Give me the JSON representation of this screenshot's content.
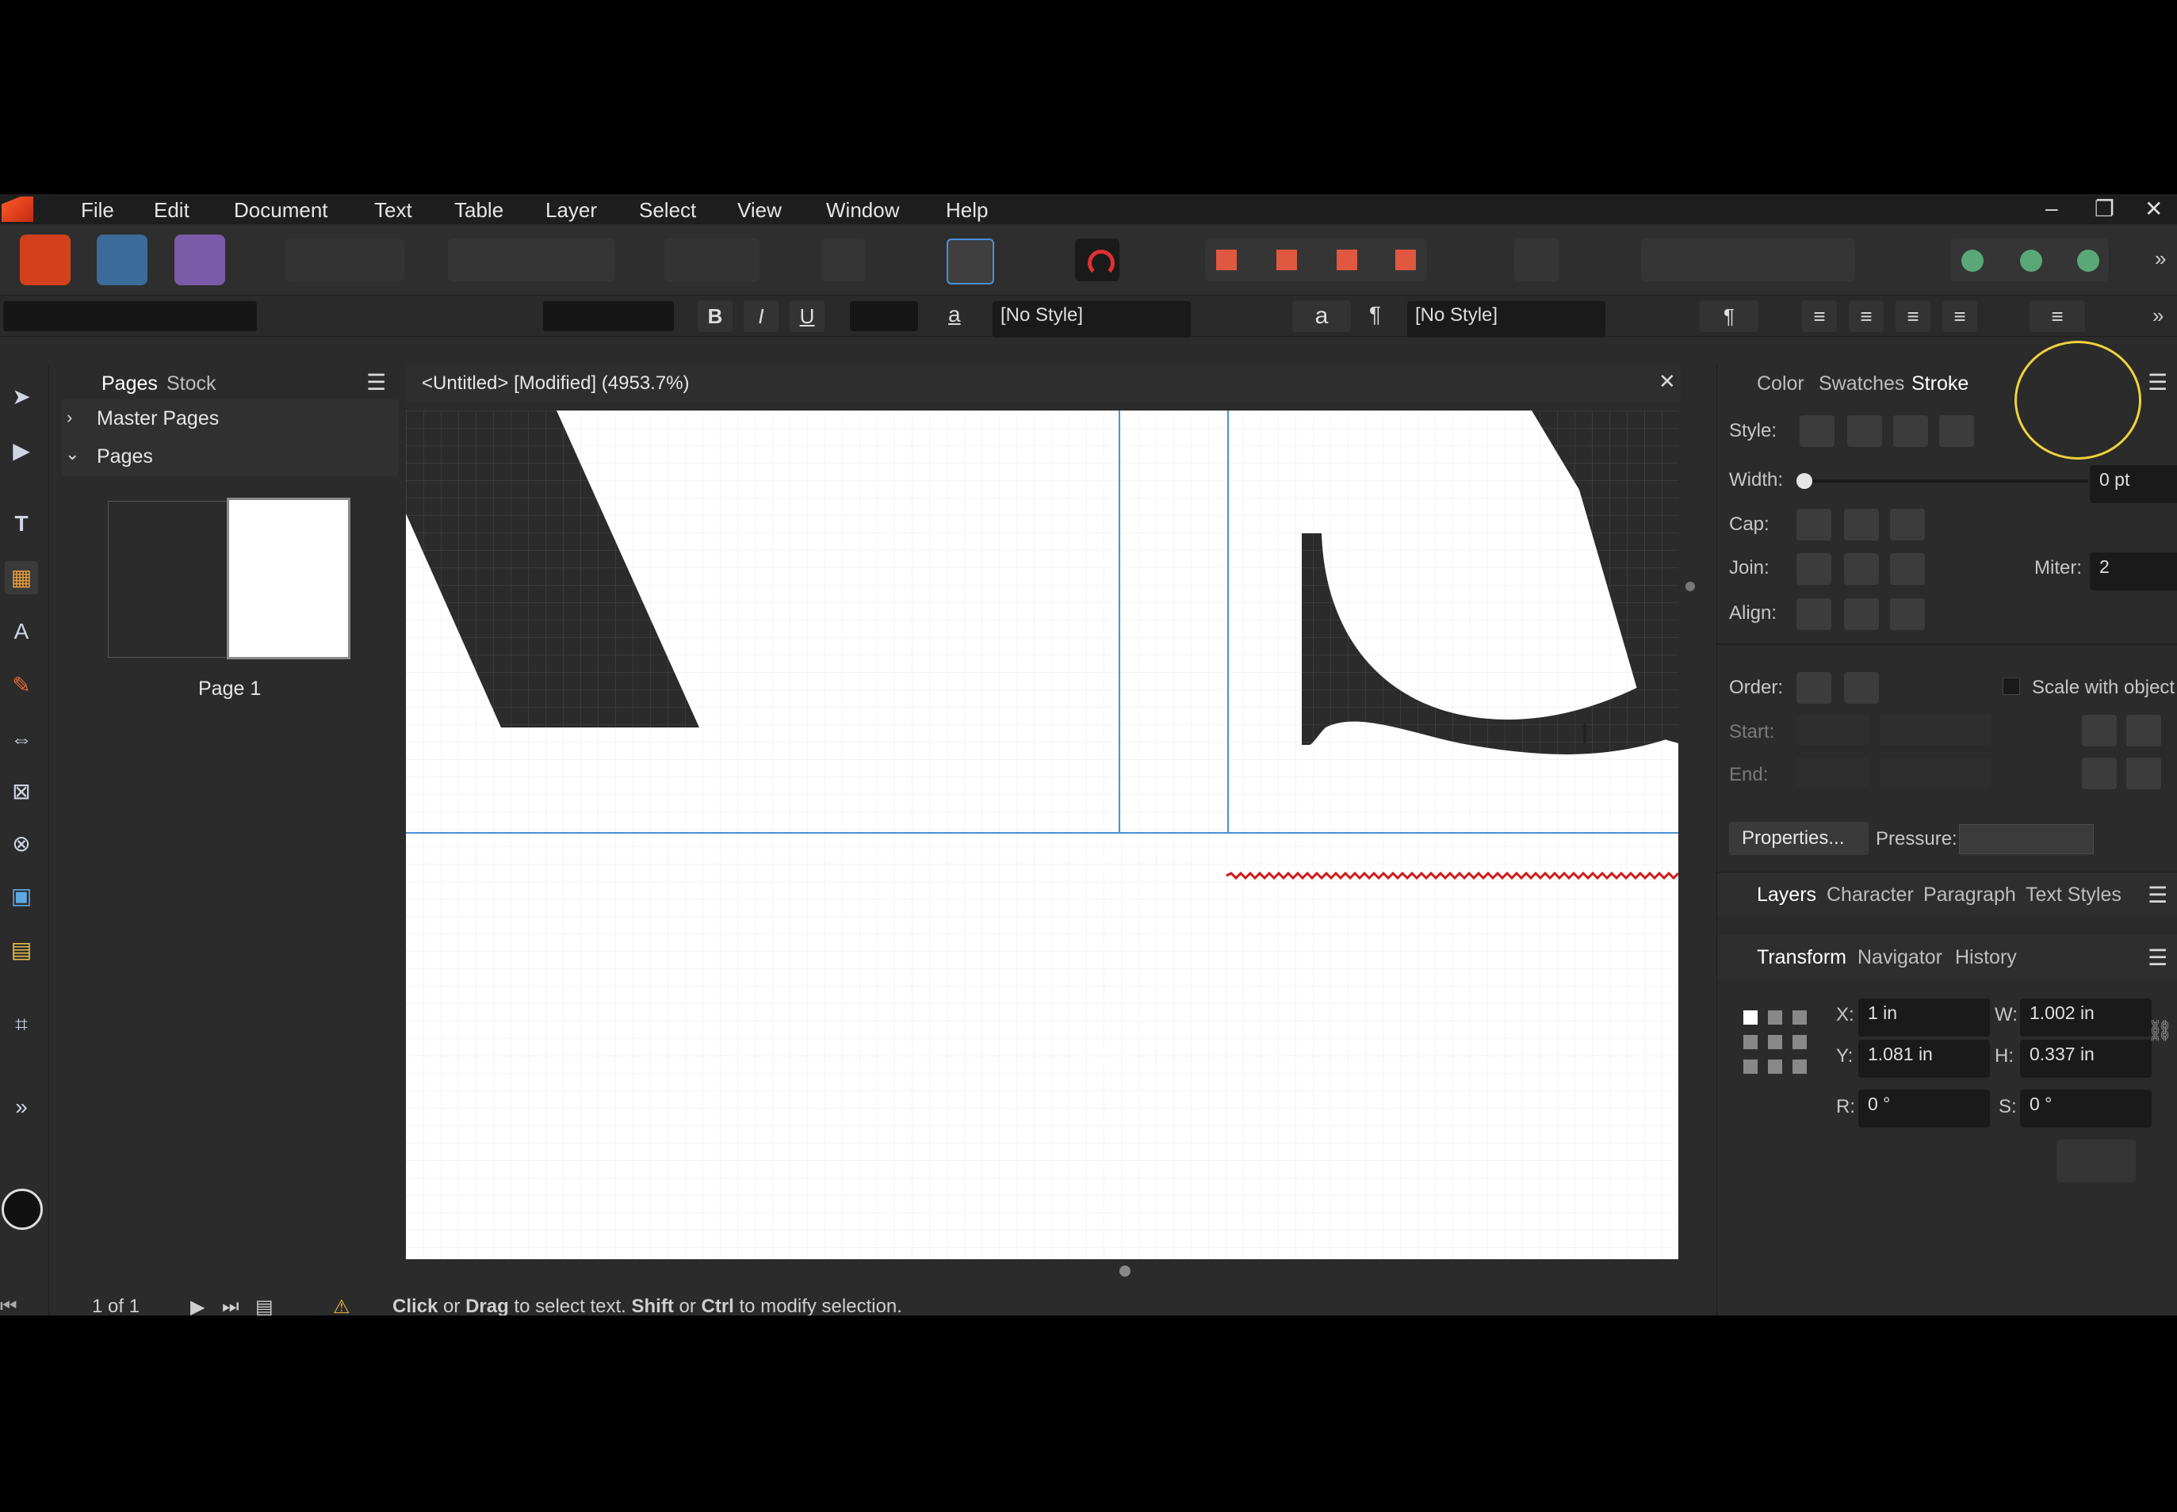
{
  "menu": [
    "File",
    "Edit",
    "Document",
    "Text",
    "Table",
    "Layer",
    "Select",
    "View",
    "Window",
    "Help"
  ],
  "context": {
    "char_style": "[No Style]",
    "para_style": "[No Style]",
    "bold": "B",
    "italic": "I",
    "underline": "U",
    "a_glyph": "a",
    "pilcrow": "¶"
  },
  "pages_panel": {
    "tab_pages": "Pages",
    "tab_stock": "Stock",
    "master_pages": "Master Pages",
    "pages": "Pages",
    "page1": "Page 1"
  },
  "document": {
    "title": "<Untitled> [Modified] (4953.7%)"
  },
  "stroke_panel": {
    "tabs": [
      "Color",
      "Swatches",
      "Stroke"
    ],
    "style_label": "Style:",
    "width_label": "Width:",
    "width_value": "0 pt",
    "cap_label": "Cap:",
    "join_label": "Join:",
    "miter_label": "Miter:",
    "miter_value": "2",
    "align_label": "Align:",
    "order_label": "Order:",
    "scale_label": "Scale with object",
    "start_label": "Start:",
    "end_label": "End:",
    "properties_button": "Properties...",
    "pressure_label": "Pressure:"
  },
  "layers_tabs": [
    "Layers",
    "Character",
    "Paragraph",
    "Text Styles"
  ],
  "transform_tabs": [
    "Transform",
    "Navigator",
    "History"
  ],
  "transform": {
    "x_label": "X:",
    "x_value": "1 in",
    "y_label": "Y:",
    "y_value": "1.081 in",
    "w_label": "W:",
    "w_value": "1.002 in",
    "h_label": "H:",
    "h_value": "0.337 in",
    "r_label": "R:",
    "r_value": "0 °",
    "s_label": "S:",
    "s_value": "0 °"
  },
  "status": {
    "page_count": "1 of 1",
    "hint_click": "Click",
    "hint_or1": " or ",
    "hint_drag": "Drag",
    "hint_mid": " to select text. ",
    "hint_shift": "Shift",
    "hint_or2": " or ",
    "hint_ctrl": "Ctrl",
    "hint_end": " to modify selection."
  },
  "colors": {
    "accent_blue": "#4a90d9",
    "highlight_yellow": "#f0d23c",
    "spell_red": "#d01a1a"
  }
}
